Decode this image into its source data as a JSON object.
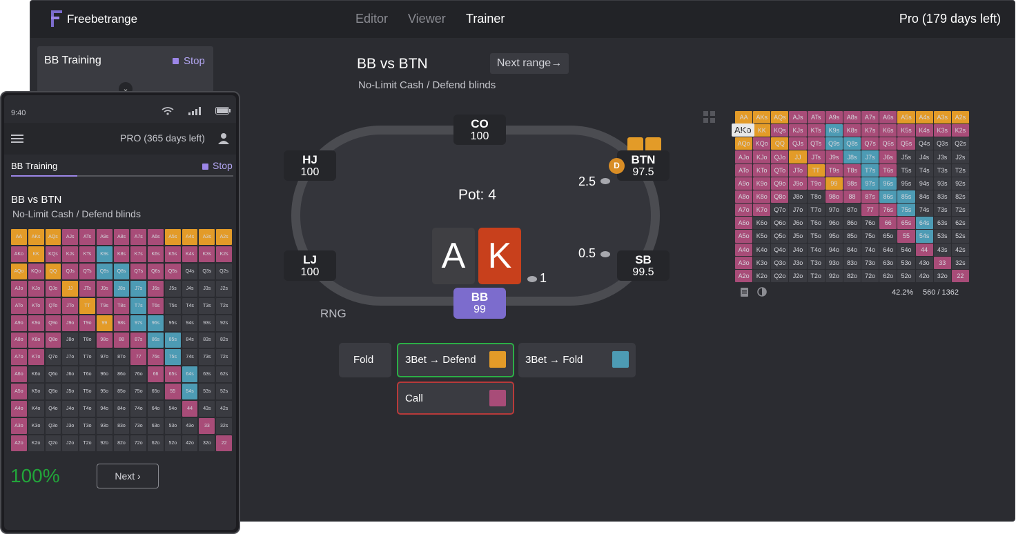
{
  "colors": {
    "defend": "#e39b28",
    "fold_bet": "#4d9bb4",
    "call": "#a84c78",
    "fold": "#3a3b41",
    "hero": "#7c6ccd"
  },
  "app": {
    "brand": "Freebetrange",
    "nav": [
      "Editor",
      "Viewer",
      "Trainer"
    ],
    "active_nav": "Trainer",
    "plan": "Pro (179 days left)"
  },
  "training": {
    "title": "BB Training",
    "stop": "Stop"
  },
  "hand": {
    "title": "BB vs BTN",
    "subtitle": "No-Limit Cash / Defend blinds",
    "next_range": "Next range→"
  },
  "table": {
    "seats": {
      "co": {
        "name": "CO",
        "stack": "100"
      },
      "hj": {
        "name": "HJ",
        "stack": "100"
      },
      "btn": {
        "name": "BTN",
        "stack": "97.5"
      },
      "lj": {
        "name": "LJ",
        "stack": "100"
      },
      "sb": {
        "name": "SB",
        "stack": "99.5"
      },
      "bb": {
        "name": "BB",
        "stack": "99"
      }
    },
    "dealer": "D",
    "pot": "Pot: 4",
    "bet_btn": "2.5",
    "bet_sb": "0.5",
    "bet_bb": "1",
    "cards": [
      {
        "rank": "A",
        "color": "#3f3f43"
      },
      {
        "rank": "K",
        "color": "#c8401c"
      }
    ],
    "rng": "RNG"
  },
  "actions": {
    "fold": "Fold",
    "defend": "3Bet → Defend",
    "fold_bet": "3Bet → Fold",
    "call": "Call"
  },
  "range": {
    "tooltip": "AKo",
    "percent": "42.2%",
    "combos": "560 / 1362"
  },
  "mobile": {
    "time": "9:40",
    "plan": "PRO (365 days left)",
    "tab": "BB Training",
    "stop": "Stop",
    "title": "BB vs BTN",
    "subtitle": "No-Limit Cash / Defend blinds",
    "accuracy": "100%",
    "next": "Next ›"
  },
  "hands": [
    [
      "AA",
      "AKs",
      "AQs",
      "AJs",
      "ATs",
      "A9s",
      "A8s",
      "A7s",
      "A6s",
      "A5s",
      "A4s",
      "A3s",
      "A2s"
    ],
    [
      "AKo",
      "KK",
      "KQs",
      "KJs",
      "KTs",
      "K9s",
      "K8s",
      "K7s",
      "K6s",
      "K5s",
      "K4s",
      "K3s",
      "K2s"
    ],
    [
      "AQo",
      "KQo",
      "QQ",
      "QJs",
      "QTs",
      "Q9s",
      "Q8s",
      "Q7s",
      "Q6s",
      "Q5s",
      "Q4s",
      "Q3s",
      "Q2s"
    ],
    [
      "AJo",
      "KJo",
      "QJo",
      "JJ",
      "JTs",
      "J9s",
      "J8s",
      "J7s",
      "J6s",
      "J5s",
      "J4s",
      "J3s",
      "J2s"
    ],
    [
      "ATo",
      "KTo",
      "QTo",
      "JTo",
      "TT",
      "T9s",
      "T8s",
      "T7s",
      "T6s",
      "T5s",
      "T4s",
      "T3s",
      "T2s"
    ],
    [
      "A9o",
      "K9o",
      "Q9o",
      "J9o",
      "T9o",
      "99",
      "98s",
      "97s",
      "96s",
      "95s",
      "94s",
      "93s",
      "92s"
    ],
    [
      "A8o",
      "K8o",
      "Q8o",
      "J8o",
      "T8o",
      "98o",
      "88",
      "87s",
      "86s",
      "85s",
      "84s",
      "83s",
      "82s"
    ],
    [
      "A7o",
      "K7o",
      "Q7o",
      "J7o",
      "T7o",
      "97o",
      "87o",
      "77",
      "76s",
      "75s",
      "74s",
      "73s",
      "72s"
    ],
    [
      "A6o",
      "K6o",
      "Q6o",
      "J6o",
      "T6o",
      "96o",
      "86o",
      "76o",
      "66",
      "65s",
      "64s",
      "63s",
      "62s"
    ],
    [
      "A5o",
      "K5o",
      "Q5o",
      "J5o",
      "T5o",
      "95o",
      "85o",
      "75o",
      "65o",
      "55",
      "54s",
      "53s",
      "52s"
    ],
    [
      "A4o",
      "K4o",
      "Q4o",
      "J4o",
      "T4o",
      "94o",
      "84o",
      "74o",
      "64o",
      "54o",
      "44",
      "43s",
      "42s"
    ],
    [
      "A3o",
      "K3o",
      "Q3o",
      "J3o",
      "T3o",
      "93o",
      "83o",
      "73o",
      "63o",
      "53o",
      "43o",
      "33",
      "32s"
    ],
    [
      "A2o",
      "K2o",
      "Q2o",
      "J2o",
      "T2o",
      "92o",
      "82o",
      "72o",
      "62o",
      "52o",
      "42o",
      "32o",
      "22"
    ]
  ],
  "strategy": [
    [
      "D",
      "D",
      "D",
      "C",
      "C",
      "C",
      "C",
      "C",
      "C",
      "D",
      "D",
      "D",
      "D"
    ],
    [
      "C",
      "D",
      "C",
      "C",
      "C",
      "B",
      "C",
      "C",
      "C",
      "C",
      "C",
      "C",
      "C"
    ],
    [
      "D",
      "C",
      "D",
      "C",
      "C",
      "B",
      "B",
      "C",
      "C",
      "C",
      "F",
      "F",
      "F"
    ],
    [
      "C",
      "C",
      "C",
      "D",
      "C",
      "C",
      "B",
      "B",
      "C",
      "F",
      "F",
      "F",
      "F"
    ],
    [
      "C",
      "C",
      "C",
      "C",
      "D",
      "C",
      "C",
      "B",
      "C",
      "F",
      "F",
      "F",
      "F"
    ],
    [
      "C",
      "C",
      "C",
      "C",
      "C",
      "D",
      "C",
      "B",
      "B",
      "F",
      "F",
      "F",
      "F"
    ],
    [
      "C",
      "C",
      "C",
      "F",
      "F",
      "C",
      "C",
      "C",
      "B",
      "B",
      "F",
      "F",
      "F"
    ],
    [
      "C",
      "C",
      "F",
      "F",
      "F",
      "F",
      "F",
      "C",
      "C",
      "B",
      "F",
      "F",
      "F"
    ],
    [
      "C",
      "F",
      "F",
      "F",
      "F",
      "F",
      "F",
      "F",
      "C",
      "C",
      "B",
      "F",
      "F"
    ],
    [
      "C",
      "F",
      "F",
      "F",
      "F",
      "F",
      "F",
      "F",
      "F",
      "C",
      "B",
      "F",
      "F"
    ],
    [
      "C",
      "F",
      "F",
      "F",
      "F",
      "F",
      "F",
      "F",
      "F",
      "F",
      "C",
      "F",
      "F"
    ],
    [
      "C",
      "F",
      "F",
      "F",
      "F",
      "F",
      "F",
      "F",
      "F",
      "F",
      "F",
      "C",
      "F"
    ],
    [
      "C",
      "F",
      "F",
      "F",
      "F",
      "F",
      "F",
      "F",
      "F",
      "F",
      "F",
      "F",
      "C"
    ]
  ]
}
